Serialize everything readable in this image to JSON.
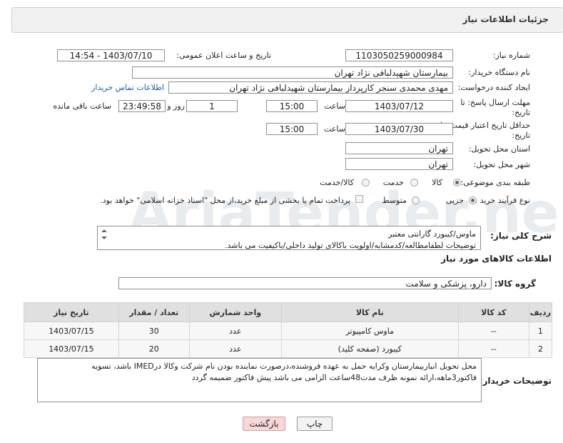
{
  "header": {
    "title": "جزئیات اطلاعات نیاز"
  },
  "fields": {
    "need_number_label": "شماره نیاز:",
    "need_number": "1103050259000984",
    "announce_label": "تاریخ و ساعت اعلان عمومی:",
    "announce_value": "1403/07/10 - 14:54",
    "buyer_org_label": "نام دستگاه خریدار:",
    "buyer_org": "بیمارستان شهیدلبافی نژاد تهران",
    "creator_label": "ایجاد کننده درخواست:",
    "creator": "مهدی محمدی سنجر کارپرداز بیمارستان شهیدلبافی نژاد تهران",
    "contact_link": "اطلاعات تماس خریدار",
    "deadline_label_1": "مهلت ارسال پاسخ: تا",
    "deadline_label_2": "تاریخ:",
    "deadline_date": "1403/07/12",
    "time_label": "ساعت",
    "deadline_time": "15:00",
    "days_value": "1",
    "days_label": "روز و",
    "remaining_time": "23:49:58",
    "remaining_label": "ساعت باقی مانده",
    "validity_label_1": "حداقل تاریخ اعتبار قیمت: تا",
    "validity_label_2": "تاریخ:",
    "validity_date": "1403/07/30",
    "validity_time": "15:00",
    "province_label": "استان محل تحویل:",
    "province": "تهران",
    "city_label": "شهر محل تحویل:",
    "city": "تهران",
    "category_label": "طبقه بندی موضوعی:",
    "category_options": [
      "کالا",
      "خدمت",
      "کالا/خدمت"
    ],
    "process_label": "نوع فرآیند خرید :",
    "process_options": [
      "جزیی",
      "متوسط"
    ],
    "payment_note": "پرداخت تمام یا بخشی از مبلغ خرید،از محل \"اسناد خزانه اسلامی\" خواهد بود."
  },
  "summary": {
    "label": "شرح کلی نیاز:",
    "line1": "ماوس/کیبورد گارانتی معتبر",
    "line2": "توضیحات لطفامطالعه/کدمشابه/اولویت باکالای تولید داخلی/باکیفیت می باشد."
  },
  "goods": {
    "section_title": "اطلاعات کالاهای مورد نیاز",
    "group_label": "گروه کالا:",
    "group_value": "دارو، پزشکی و سلامت",
    "columns": [
      "ردیف",
      "کد کالا",
      "نام کالا",
      "واحد شمارش",
      "تعداد / مقدار",
      "تاریخ نیاز"
    ],
    "rows": [
      {
        "row": "1",
        "code": "--",
        "name": "ماوس کامپیوتر",
        "unit": "عدد",
        "qty": "30",
        "date": "1403/07/15"
      },
      {
        "row": "2",
        "code": "--",
        "name": "کیبورد (صفحه کلید)",
        "unit": "عدد",
        "qty": "20",
        "date": "1403/07/15"
      }
    ]
  },
  "buyer_notes": {
    "label": "توضیحات خریدار:",
    "text": "محل تحویل انباربیمارستان وکرایه حمل به عهده فروشنده،درصورت نماینده بودن نام شرکت وکالا درIMED باشد، تسویه فاکتور3ماهه،ارائه نمونه ظرف مدت48ساعت الزامی می باشد پیش فاکتور ضمیمه گردد"
  },
  "buttons": {
    "print": "چاپ",
    "back": "بازگشت"
  },
  "watermark_text": "AriaTender.net",
  "colors": {
    "link": "#1e5aa8",
    "header_bg": "#f1f1f1",
    "back_button_bg": "#f8d7d7"
  }
}
